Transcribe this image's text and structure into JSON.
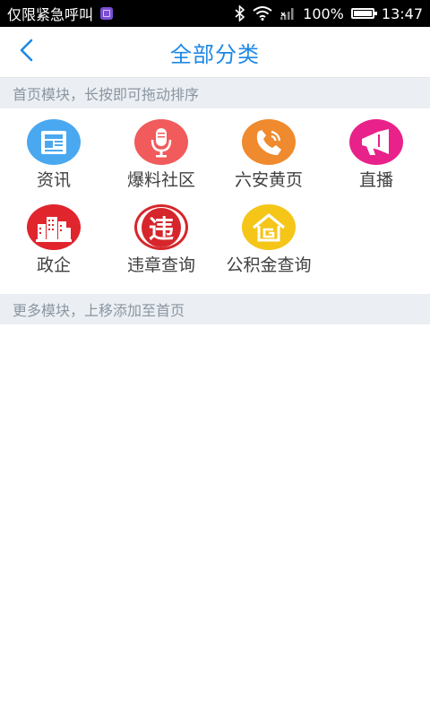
{
  "statusbar": {
    "left_text": "仅限紧急呼叫",
    "app_icon": "gallery-app-icon",
    "battery": "100%",
    "battery_level": 1.0,
    "time": "13:47"
  },
  "header": {
    "title": "全部分类",
    "back_icon": "chevron-left-icon",
    "accent_color": "#1e88e5"
  },
  "sections": {
    "home_modules": "首页模块，长按即可拖动排序",
    "more_modules": "更多模块，上移添加至首页"
  },
  "modules": [
    {
      "label": "资讯",
      "icon": "news-icon",
      "color": "#4aa8f0"
    },
    {
      "label": "爆料社区",
      "icon": "microphone-icon",
      "color": "#f15b5b"
    },
    {
      "label": "六安黄页",
      "icon": "phone-icon",
      "color": "#f08a2e"
    },
    {
      "label": "直播",
      "icon": "megaphone-icon",
      "color": "#e8228a"
    },
    {
      "label": "政企",
      "icon": "buildings-icon",
      "color": "#e0252d"
    },
    {
      "label": "违章查询",
      "icon": "violation-badge-icon",
      "color": "#d6262b",
      "glyph": "违"
    },
    {
      "label": "公积金查询",
      "icon": "house-icon",
      "color": "#f5c518"
    }
  ]
}
